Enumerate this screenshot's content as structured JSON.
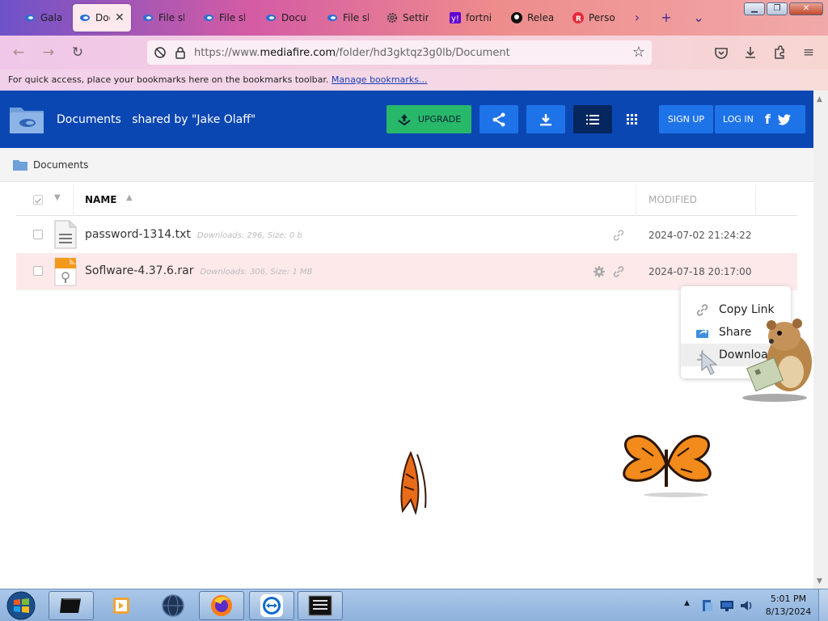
{
  "browser": {
    "tabs": [
      {
        "title": "Galaxy",
        "icon": "mediafire-icon"
      },
      {
        "title": "Documents",
        "icon": "mediafire-icon",
        "active": true
      },
      {
        "title": "File sharing",
        "icon": "mediafire-icon"
      },
      {
        "title": "File sharing",
        "icon": "mediafire-icon"
      },
      {
        "title": "Documents",
        "icon": "mediafire-icon"
      },
      {
        "title": "File sharing",
        "icon": "mediafire-icon"
      },
      {
        "title": "Settings",
        "icon": "gear-icon"
      },
      {
        "title": "fortnite",
        "icon": "yahoo-icon"
      },
      {
        "title": "Releases",
        "icon": "github-icon"
      },
      {
        "title": "Personal",
        "icon": "r-icon"
      }
    ],
    "url_prefix": "https://www.",
    "url_host": "mediafire.com",
    "url_path": "/folder/hd3gktqz3g0lb/Document",
    "bookmarks_text": "For quick access, place your bookmarks here on the bookmarks toolbar.",
    "bookmarks_link": "Manage bookmarks..."
  },
  "header": {
    "folder_name": "Documents",
    "shared_by": "shared by \"Jake Olaff\"",
    "upgrade_label": "UPGRADE",
    "signup_label": "SIGN UP",
    "login_label": "LOG IN",
    "colors": {
      "bar": "#0b47b3",
      "upgrade": "#27b86a",
      "button": "#1e73e8"
    }
  },
  "breadcrumb": {
    "label": "Documents"
  },
  "table": {
    "col_name": "NAME",
    "col_modified": "MODIFIED",
    "rows": [
      {
        "name": "password-1314.txt",
        "meta": "Downloads: 296, Size: 0 b",
        "date": "2024-07-02 21:24:22",
        "icon": "text-file-icon"
      },
      {
        "name": "Soflware-4.37.6.rar",
        "meta": "Downloads: 306, Size: 1 MB",
        "date": "2024-07-18 20:17:00",
        "icon": "archive-file-icon"
      }
    ]
  },
  "context_menu": {
    "items": [
      {
        "label": "Copy Link",
        "icon": "link-icon"
      },
      {
        "label": "Share",
        "icon": "share-icon"
      },
      {
        "label": "Download",
        "icon": "download-icon"
      }
    ]
  },
  "taskbar": {
    "time": "5:01 PM",
    "date": "8/13/2024"
  }
}
